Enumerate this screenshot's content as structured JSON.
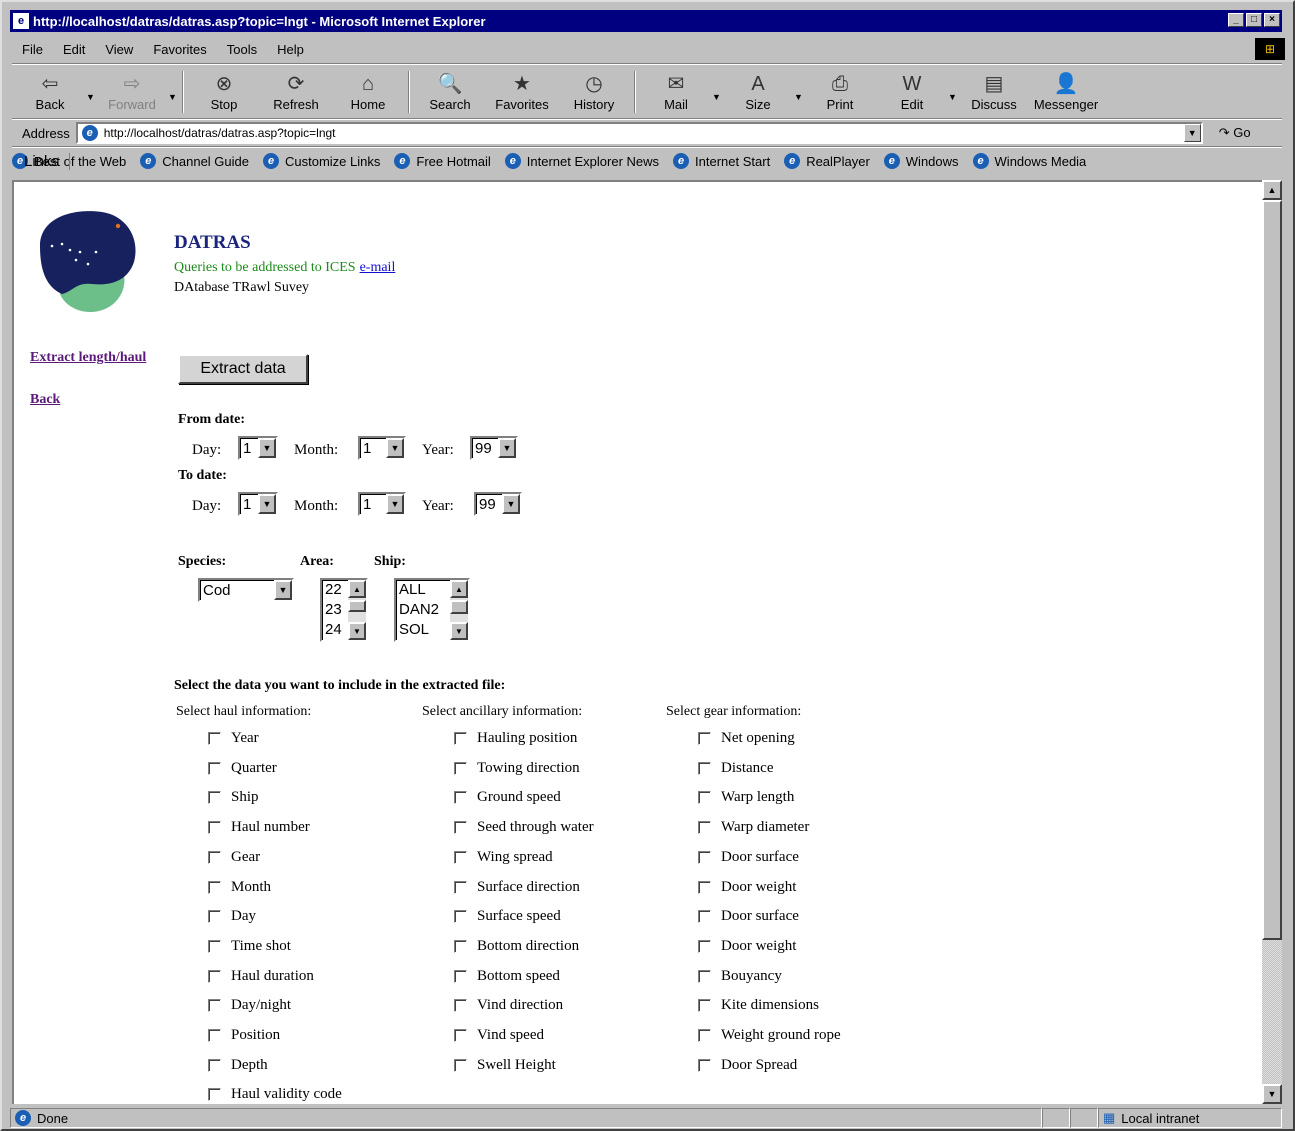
{
  "window": {
    "title": "http://localhost/datras/datras.asp?topic=lngt - Microsoft Internet Explorer",
    "controls": {
      "minimize": "_",
      "maximize": "□",
      "close": "×"
    }
  },
  "menu": [
    "File",
    "Edit",
    "View",
    "Favorites",
    "Tools",
    "Help"
  ],
  "toolbar": [
    {
      "label": "Back",
      "icon": "back-arrow",
      "glyph": "⇦",
      "enabled": true,
      "dropdown": true
    },
    {
      "label": "Forward",
      "icon": "forward-arrow",
      "glyph": "⇨",
      "enabled": false,
      "dropdown": true
    },
    {
      "label": "Stop",
      "icon": "stop",
      "glyph": "⊗",
      "enabled": true
    },
    {
      "label": "Refresh",
      "icon": "refresh",
      "glyph": "⟳",
      "enabled": true
    },
    {
      "label": "Home",
      "icon": "home",
      "glyph": "⌂",
      "enabled": true
    },
    {
      "label": "Search",
      "icon": "search",
      "glyph": "🔍",
      "enabled": true
    },
    {
      "label": "Favorites",
      "icon": "favorites",
      "glyph": "★",
      "enabled": true
    },
    {
      "label": "History",
      "icon": "history",
      "glyph": "◷",
      "enabled": true
    },
    {
      "label": "Mail",
      "icon": "mail",
      "glyph": "✉",
      "enabled": true,
      "dropdown": true
    },
    {
      "label": "Size",
      "icon": "font-size",
      "glyph": "A",
      "enabled": true,
      "dropdown": true
    },
    {
      "label": "Print",
      "icon": "print",
      "glyph": "⎙",
      "enabled": true
    },
    {
      "label": "Edit",
      "icon": "edit",
      "glyph": "W",
      "enabled": true,
      "dropdown": true
    },
    {
      "label": "Discuss",
      "icon": "discuss",
      "glyph": "▤",
      "enabled": true
    },
    {
      "label": "Messenger",
      "icon": "messenger",
      "glyph": "👤",
      "enabled": true
    }
  ],
  "address": {
    "label": "Address",
    "url": "http://localhost/datras/datras.asp?topic=lngt",
    "go": "Go"
  },
  "links": {
    "label": "Links",
    "items": [
      "Best of the Web",
      "Channel Guide",
      "Customize Links",
      "Free Hotmail",
      "Internet Explorer News",
      "Internet Start",
      "RealPlayer",
      "Windows",
      "Windows Media"
    ]
  },
  "page": {
    "title": "DATRAS",
    "subtitle": "Queries to be addressed to ICES",
    "email_link": "e-mail",
    "description": "DAtabase TRawl Suvey",
    "side_links": [
      "Extract length/haul",
      "Back"
    ],
    "extract_button": "Extract data",
    "from_date": {
      "heading": "From date:",
      "day_label": "Day:",
      "day": "1",
      "month_label": "Month:",
      "month": "1",
      "year_label": "Year:",
      "year": "99"
    },
    "to_date": {
      "heading": "To date:",
      "day_label": "Day:",
      "day": "1",
      "month_label": "Month:",
      "month": "1",
      "year_label": "Year:",
      "year": "99"
    },
    "species": {
      "label": "Species:",
      "value": "Cod"
    },
    "area": {
      "label": "Area:",
      "options": [
        "22",
        "23",
        "24"
      ]
    },
    "ship": {
      "label": "Ship:",
      "options": [
        "ALL",
        "DAN2",
        "SOL"
      ]
    },
    "select_heading": "Select the data you want to include in the extracted file:",
    "haul": {
      "heading": "Select haul information:",
      "items": [
        "Year",
        "Quarter",
        "Ship",
        "Haul number",
        "Gear",
        "Month",
        "Day",
        "Time shot",
        "Haul duration",
        "Day/night",
        "Position",
        "Depth",
        "Haul validity code"
      ]
    },
    "ancillary": {
      "heading": "Select ancillary information:",
      "items": [
        "Hauling position",
        "Towing direction",
        "Ground speed",
        "Seed through water",
        "Wing spread",
        "Surface direction",
        "Surface speed",
        "Bottom direction",
        "Bottom speed",
        "Vind direction",
        "Vind speed",
        "Swell Height"
      ]
    },
    "gear": {
      "heading": "Select gear information:",
      "items": [
        "Net opening",
        "Distance",
        "Warp length",
        "Warp diameter",
        "Door surface",
        "Door weight",
        "Door surface",
        "Door weight",
        "Bouyancy",
        "Kite dimensions",
        "Weight ground rope",
        "Door Spread"
      ]
    }
  },
  "status": {
    "text": "Done",
    "zone": "Local intranet"
  },
  "colors": {
    "titlebar": "#000080",
    "page_title": "#1a237e",
    "subtitle": "#1b8a1b",
    "visited_link": "#5b1a7a",
    "link": "#1010d0"
  }
}
